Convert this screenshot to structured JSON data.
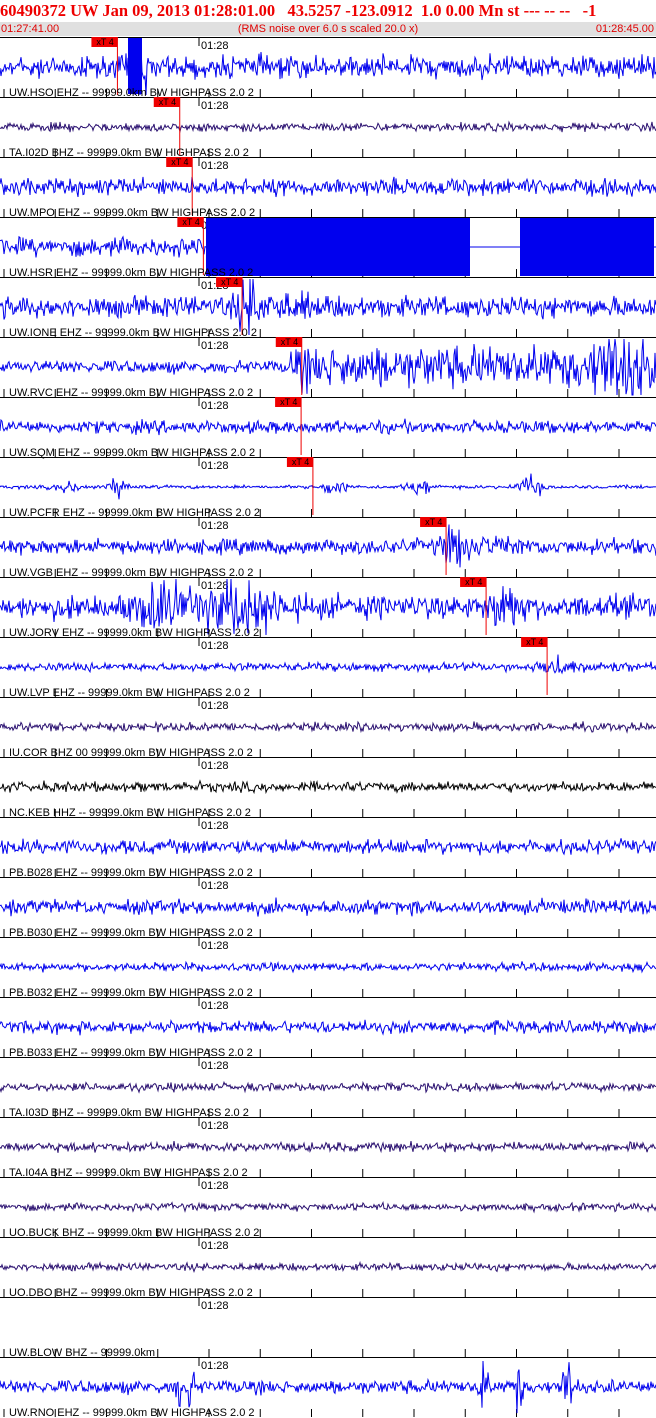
{
  "header": {
    "title": "60490372 UW Jan 09, 2013 01:28:01.00   43.5257 -123.0912  1.0 0.00 Mn st --- -- --   -1",
    "start_time": "01:27:41.00",
    "rms_note": "(RMS noise over 6.0 s scaled 20.0 x)",
    "end_time": "01:28:45.00"
  },
  "colors": {
    "trace_blue": "#0000ee",
    "trace_dark": "#2a1070",
    "trace_black": "#000000",
    "pick_red": "#ee0000",
    "title_red": "#ee0000",
    "subtitle_bg": "#e0e0e0"
  },
  "chart_data": {
    "type": "seismogram",
    "time_range": [
      "01:27:41.00",
      "01:28:45.00"
    ],
    "time_label": "01:28",
    "panels": [
      {
        "label": "UW.HSO EHZ -- 99999.0km BW  HIGHPASS  2.0  2",
        "pick": "xT 4",
        "pick_time": 0.179,
        "color": "blue",
        "amp": 0.33,
        "mode": "hso"
      },
      {
        "label": "TA.I02D BHZ -- 99999.0km BW  HIGHPASS  2.0  2",
        "pick": "xT 4",
        "pick_time": 0.274,
        "color": "dark",
        "amp": 0.1,
        "mode": "noise"
      },
      {
        "label": "UW.MPO EHZ -- 99999.0km BW  HIGHPASS  2.0  2",
        "pick": "xT 4",
        "pick_time": 0.293,
        "color": "blue",
        "amp": 0.2,
        "mode": "noise"
      },
      {
        "label": "UW.HSR EHZ -- 99999.0km BW  HIGHPASS  2.0  2",
        "pick": "xT 4",
        "pick_time": 0.31,
        "color": "blue",
        "amp": 0.22,
        "mode": "hsr"
      },
      {
        "label": "UW.IONE EHZ -- 99999.0km BW  HIGHPASS  2.0  2",
        "pick": "xT 4",
        "pick_time": 0.369,
        "color": "blue",
        "amp": 0.25,
        "mode": "event"
      },
      {
        "label": "UW.RVC EHZ -- 99999.0km BW  HIGHPASS  2.0  2",
        "pick": "xT 4",
        "pick_time": 0.46,
        "color": "blue",
        "amp": 0.3,
        "mode": "rvc"
      },
      {
        "label": "UW.SQM EHZ -- 99999.0km BW  HIGHPASS  2.0  2",
        "pick": "xT 4",
        "pick_time": 0.459,
        "color": "blue",
        "amp": 0.15,
        "mode": "noise"
      },
      {
        "label": "UW.PCFR EHZ -- 99999.0km BW  HIGHPASS  2.0  2",
        "pick": "xT 4",
        "pick_time": 0.477,
        "color": "blue",
        "amp": 0.04,
        "mode": "bursts"
      },
      {
        "label": "UW.VGB EHZ -- 99999.0km BW  HIGHPASS  2.0  2",
        "pick": "xT 4",
        "pick_time": 0.68,
        "color": "blue",
        "amp": 0.18,
        "mode": "event"
      },
      {
        "label": "UW.JORV EHZ -- 99999.0km BW  HIGHPASS  2.0  2",
        "pick": "xT 4",
        "pick_time": 0.741,
        "color": "blue",
        "amp": 0.28,
        "mode": "jorv"
      },
      {
        "label": "UW.LVP EHZ -- 99999.0km BW  HIGHPASS  2.0  2",
        "pick": "xT 4",
        "pick_time": 0.834,
        "color": "blue",
        "amp": 0.1,
        "mode": "event"
      },
      {
        "label": "IU.COR BHZ 00 99999.0km BW  HIGHPASS  2.0  2",
        "pick": "",
        "color": "dark",
        "amp": 0.1,
        "mode": "noise"
      },
      {
        "label": "NC.KEB HHZ -- 99999.0km BW  HIGHPASS  2.0  2",
        "pick": "",
        "color": "black",
        "amp": 0.12,
        "mode": "noise"
      },
      {
        "label": "PB.B028 EHZ -- 99999.0km BW  HIGHPASS  2.0  2",
        "pick": "",
        "color": "blue",
        "amp": 0.17,
        "mode": "noise"
      },
      {
        "label": "PB.B030 EHZ -- 99999.0km BW  HIGHPASS  2.0  2",
        "pick": "",
        "color": "blue",
        "amp": 0.17,
        "mode": "noise"
      },
      {
        "label": "PB.B032 EHZ -- 99999.0km BW  HIGHPASS  2.0  2",
        "pick": "",
        "color": "blue",
        "amp": 0.1,
        "mode": "noise"
      },
      {
        "label": "PB.B033 EHZ -- 99999.0km BW  HIGHPASS  2.0  2",
        "pick": "",
        "color": "blue",
        "amp": 0.15,
        "mode": "noise"
      },
      {
        "label": "TA.I03D BHZ -- 99999.0km BW  HIGHPASS  2.0  2",
        "pick": "",
        "color": "dark",
        "amp": 0.1,
        "mode": "noise"
      },
      {
        "label": "TA.I04A BHZ -- 99999.0km BW  HIGHPASS  2.0  2",
        "pick": "",
        "color": "dark",
        "amp": 0.11,
        "mode": "noise"
      },
      {
        "label": "UO.BUCK BHZ -- 99999.0km BW  HIGHPASS  2.0  2",
        "pick": "",
        "color": "dark",
        "amp": 0.09,
        "mode": "noise"
      },
      {
        "label": "UO.DBO BHZ -- 99999.0km BW  HIGHPASS  2.0  2",
        "pick": "",
        "color": "dark",
        "amp": 0.09,
        "mode": "noise"
      },
      {
        "label": "UW.BLOW BHZ -- 99999.0km",
        "pick": "",
        "color": "none",
        "amp": 0,
        "mode": "flat"
      },
      {
        "label": "UW.RNO EHZ -- 99999.0km BW  HIGHPASS  2.0  2",
        "pick": "",
        "color": "blue",
        "amp": 0.2,
        "mode": "rno"
      }
    ]
  }
}
